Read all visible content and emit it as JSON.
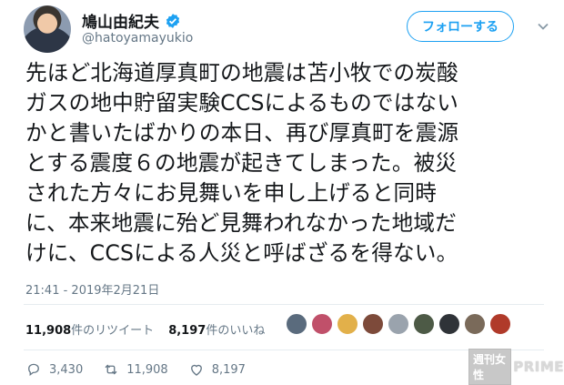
{
  "user": {
    "display_name": "鳩山由紀夫",
    "handle": "@hatoyamayukio"
  },
  "follow_label": "フォローする",
  "tweet": {
    "lines": [
      "先ほど北海道厚真町の地震は苫小牧での炭酸",
      "ガスの地中貯留実験CCSによるものではない",
      "かと書いたばかりの本日、再び厚真町を震源",
      "とする震度６の地震が起きてしまった。被災",
      "された方々にお見舞いを申し上げると同時",
      "に、本来地震に殆ど見舞われなかった地域だ",
      "けに、CCSによる人災と呼ばざるを得ない。"
    ],
    "timestamp": "21:41 - 2019年2月21日"
  },
  "stats": {
    "retweets_count": "11,908",
    "retweets_label": "件のリツイート",
    "likes_count": "8,197",
    "likes_label": "件のいいね"
  },
  "likers": [
    "#5a6b7d",
    "#c0506a",
    "#e2b04a",
    "#7d4a3a",
    "#9aa3ad",
    "#4d5a46",
    "#2f3338",
    "#7a6a5a",
    "#b03a2a"
  ],
  "actions": {
    "reply_count": "3,430",
    "retweet_count": "11,908",
    "like_count": "8,197"
  },
  "watermark": {
    "part1": "週刊女性",
    "part2": "PRIME"
  },
  "colors": {
    "accent": "#1da1f2",
    "text": "#14171a",
    "muted": "#657786"
  }
}
